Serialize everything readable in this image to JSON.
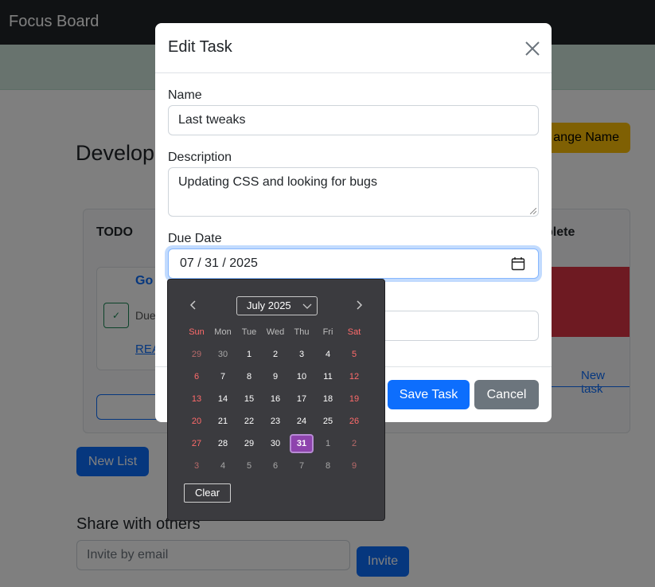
{
  "navbar": {
    "brand": "Focus Board"
  },
  "board": {
    "title": "Develop",
    "change_name_label": "ange Name",
    "lists": [
      {
        "title": "TODO"
      },
      {
        "title": "plete"
      }
    ],
    "todo_card": {
      "title": "Go",
      "due_text": "Due",
      "link_text": "REA"
    },
    "complete_card": {
      "new_task_label": "New task"
    },
    "new_list_label": "New List"
  },
  "share": {
    "title": "Share with others",
    "invite_placeholder": "Invite by email",
    "invite_label": "Invite"
  },
  "modal": {
    "title": "Edit Task",
    "name_label": "Name",
    "name_value": "Last tweaks",
    "description_label": "Description",
    "description_value": "Updating CSS and looking for bugs",
    "due_label": "Due Date",
    "due_value": "07 / 31 / 2025",
    "save_label": "Save Task",
    "cancel_label": "Cancel"
  },
  "picker": {
    "month_year": "July 2025",
    "weekdays": [
      "Sun",
      "Mon",
      "Tue",
      "Wed",
      "Thu",
      "Fri",
      "Sat"
    ],
    "weeks": [
      [
        "29",
        "30",
        "1",
        "2",
        "3",
        "4",
        "5"
      ],
      [
        "6",
        "7",
        "8",
        "9",
        "10",
        "11",
        "12"
      ],
      [
        "13",
        "14",
        "15",
        "16",
        "17",
        "18",
        "19"
      ],
      [
        "20",
        "21",
        "22",
        "23",
        "24",
        "25",
        "26"
      ],
      [
        "27",
        "28",
        "29",
        "30",
        "31",
        "1",
        "2"
      ],
      [
        "3",
        "4",
        "5",
        "6",
        "7",
        "8",
        "9"
      ]
    ],
    "selected_day": "31",
    "clear_label": "Clear",
    "colors": {
      "background": "#3b3b3f",
      "selected": "#8e44ad",
      "weekend": "#ff6b6b"
    }
  },
  "icons": {
    "close": "close-icon",
    "calendar": "calendar-icon",
    "prev": "chevron-left-icon",
    "next": "chevron-right-icon",
    "month_dropdown": "chevron-down-icon",
    "check": "check-icon"
  }
}
